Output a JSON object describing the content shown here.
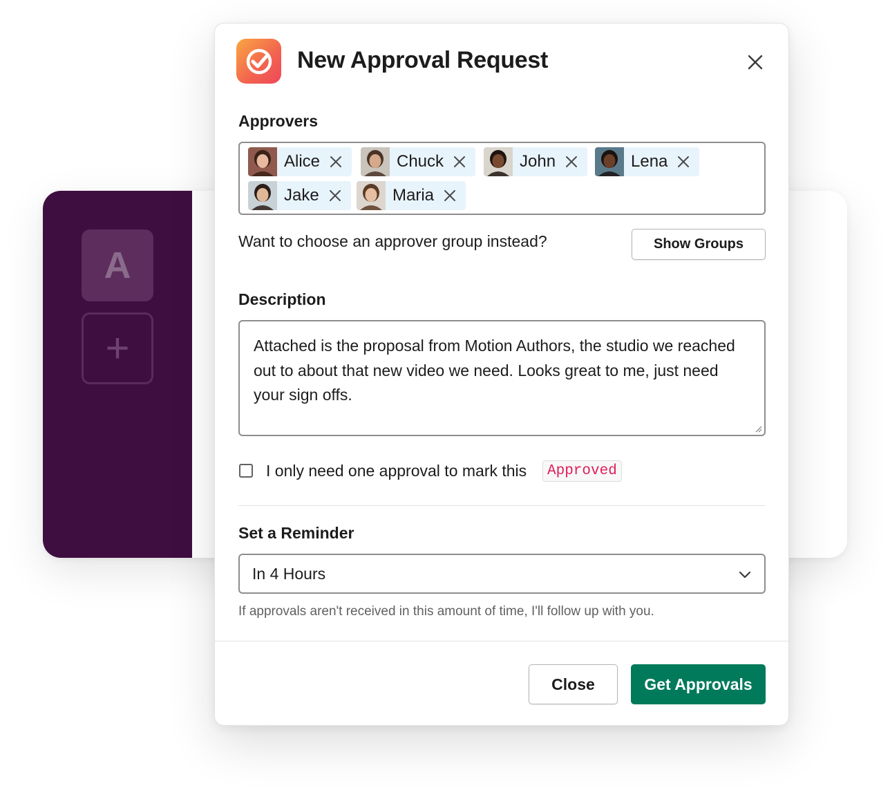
{
  "background": {
    "workspace_initial": "A",
    "add_workspace_glyph": "+",
    "sidebar_color": "#3f0e40"
  },
  "modal": {
    "title": "New Approval Request",
    "app_icon": "checkmark-circle-icon",
    "approvers_label": "Approvers",
    "approvers": [
      {
        "name": "Alice",
        "avatar_bg": "#8f5a4d",
        "skin": "#e8b8a0",
        "hair": "#3a2018"
      },
      {
        "name": "Chuck",
        "avatar_bg": "#c9c4bc",
        "skin": "#d6a98c",
        "hair": "#4a3324"
      },
      {
        "name": "John",
        "avatar_bg": "#d9d4cc",
        "skin": "#7a4a30",
        "hair": "#1f1410"
      },
      {
        "name": "Lena",
        "avatar_bg": "#5a7a8a",
        "skin": "#6b3f2a",
        "hair": "#1a1210"
      },
      {
        "name": "Jake",
        "avatar_bg": "#c8d2d6",
        "skin": "#e0b898",
        "hair": "#2a1e18"
      },
      {
        "name": "Maria",
        "avatar_bg": "#dcd6cf",
        "skin": "#e6bfa2",
        "hair": "#5a3a24"
      }
    ],
    "group_prompt": "Want to choose an approver group instead?",
    "show_groups_label": "Show Groups",
    "description_label": "Description",
    "description_text": "Attached is the proposal from Motion Authors, the studio we reached out to about that new video we need. Looks great to me, just need your sign offs.",
    "single_approval_text": "I only need one approval to mark this",
    "single_approval_code": "Approved",
    "single_approval_checked": false,
    "reminder_label": "Set a Reminder",
    "reminder_value": "In 4 Hours",
    "reminder_hint": "If approvals aren't received in this amount of time, I'll follow up with you.",
    "close_label": "Close",
    "submit_label": "Get Approvals",
    "colors": {
      "primary": "#007a5a",
      "chip_bg": "#e8f4fb",
      "code": "#e01e5a"
    }
  }
}
